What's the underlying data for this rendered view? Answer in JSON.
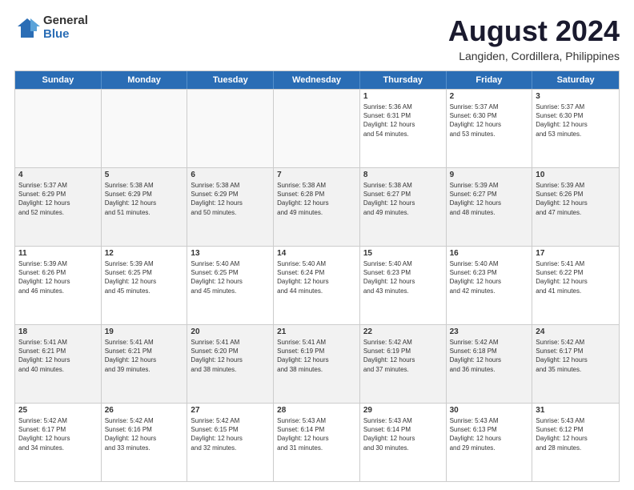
{
  "logo": {
    "general": "General",
    "blue": "Blue"
  },
  "title": "August 2024",
  "subtitle": "Langiden, Cordillera, Philippines",
  "header_days": [
    "Sunday",
    "Monday",
    "Tuesday",
    "Wednesday",
    "Thursday",
    "Friday",
    "Saturday"
  ],
  "weeks": [
    [
      {
        "day": "",
        "empty": true
      },
      {
        "day": "",
        "empty": true
      },
      {
        "day": "",
        "empty": true
      },
      {
        "day": "",
        "empty": true
      },
      {
        "day": "1",
        "lines": [
          "Sunrise: 5:36 AM",
          "Sunset: 6:31 PM",
          "Daylight: 12 hours",
          "and 54 minutes."
        ]
      },
      {
        "day": "2",
        "lines": [
          "Sunrise: 5:37 AM",
          "Sunset: 6:30 PM",
          "Daylight: 12 hours",
          "and 53 minutes."
        ]
      },
      {
        "day": "3",
        "lines": [
          "Sunrise: 5:37 AM",
          "Sunset: 6:30 PM",
          "Daylight: 12 hours",
          "and 53 minutes."
        ]
      }
    ],
    [
      {
        "day": "4",
        "lines": [
          "Sunrise: 5:37 AM",
          "Sunset: 6:29 PM",
          "Daylight: 12 hours",
          "and 52 minutes."
        ]
      },
      {
        "day": "5",
        "lines": [
          "Sunrise: 5:38 AM",
          "Sunset: 6:29 PM",
          "Daylight: 12 hours",
          "and 51 minutes."
        ]
      },
      {
        "day": "6",
        "lines": [
          "Sunrise: 5:38 AM",
          "Sunset: 6:29 PM",
          "Daylight: 12 hours",
          "and 50 minutes."
        ]
      },
      {
        "day": "7",
        "lines": [
          "Sunrise: 5:38 AM",
          "Sunset: 6:28 PM",
          "Daylight: 12 hours",
          "and 49 minutes."
        ]
      },
      {
        "day": "8",
        "lines": [
          "Sunrise: 5:38 AM",
          "Sunset: 6:27 PM",
          "Daylight: 12 hours",
          "and 49 minutes."
        ]
      },
      {
        "day": "9",
        "lines": [
          "Sunrise: 5:39 AM",
          "Sunset: 6:27 PM",
          "Daylight: 12 hours",
          "and 48 minutes."
        ]
      },
      {
        "day": "10",
        "lines": [
          "Sunrise: 5:39 AM",
          "Sunset: 6:26 PM",
          "Daylight: 12 hours",
          "and 47 minutes."
        ]
      }
    ],
    [
      {
        "day": "11",
        "lines": [
          "Sunrise: 5:39 AM",
          "Sunset: 6:26 PM",
          "Daylight: 12 hours",
          "and 46 minutes."
        ]
      },
      {
        "day": "12",
        "lines": [
          "Sunrise: 5:39 AM",
          "Sunset: 6:25 PM",
          "Daylight: 12 hours",
          "and 45 minutes."
        ]
      },
      {
        "day": "13",
        "lines": [
          "Sunrise: 5:40 AM",
          "Sunset: 6:25 PM",
          "Daylight: 12 hours",
          "and 45 minutes."
        ]
      },
      {
        "day": "14",
        "lines": [
          "Sunrise: 5:40 AM",
          "Sunset: 6:24 PM",
          "Daylight: 12 hours",
          "and 44 minutes."
        ]
      },
      {
        "day": "15",
        "lines": [
          "Sunrise: 5:40 AM",
          "Sunset: 6:23 PM",
          "Daylight: 12 hours",
          "and 43 minutes."
        ]
      },
      {
        "day": "16",
        "lines": [
          "Sunrise: 5:40 AM",
          "Sunset: 6:23 PM",
          "Daylight: 12 hours",
          "and 42 minutes."
        ]
      },
      {
        "day": "17",
        "lines": [
          "Sunrise: 5:41 AM",
          "Sunset: 6:22 PM",
          "Daylight: 12 hours",
          "and 41 minutes."
        ]
      }
    ],
    [
      {
        "day": "18",
        "lines": [
          "Sunrise: 5:41 AM",
          "Sunset: 6:21 PM",
          "Daylight: 12 hours",
          "and 40 minutes."
        ]
      },
      {
        "day": "19",
        "lines": [
          "Sunrise: 5:41 AM",
          "Sunset: 6:21 PM",
          "Daylight: 12 hours",
          "and 39 minutes."
        ]
      },
      {
        "day": "20",
        "lines": [
          "Sunrise: 5:41 AM",
          "Sunset: 6:20 PM",
          "Daylight: 12 hours",
          "and 38 minutes."
        ]
      },
      {
        "day": "21",
        "lines": [
          "Sunrise: 5:41 AM",
          "Sunset: 6:19 PM",
          "Daylight: 12 hours",
          "and 38 minutes."
        ]
      },
      {
        "day": "22",
        "lines": [
          "Sunrise: 5:42 AM",
          "Sunset: 6:19 PM",
          "Daylight: 12 hours",
          "and 37 minutes."
        ]
      },
      {
        "day": "23",
        "lines": [
          "Sunrise: 5:42 AM",
          "Sunset: 6:18 PM",
          "Daylight: 12 hours",
          "and 36 minutes."
        ]
      },
      {
        "day": "24",
        "lines": [
          "Sunrise: 5:42 AM",
          "Sunset: 6:17 PM",
          "Daylight: 12 hours",
          "and 35 minutes."
        ]
      }
    ],
    [
      {
        "day": "25",
        "lines": [
          "Sunrise: 5:42 AM",
          "Sunset: 6:17 PM",
          "Daylight: 12 hours",
          "and 34 minutes."
        ]
      },
      {
        "day": "26",
        "lines": [
          "Sunrise: 5:42 AM",
          "Sunset: 6:16 PM",
          "Daylight: 12 hours",
          "and 33 minutes."
        ]
      },
      {
        "day": "27",
        "lines": [
          "Sunrise: 5:42 AM",
          "Sunset: 6:15 PM",
          "Daylight: 12 hours",
          "and 32 minutes."
        ]
      },
      {
        "day": "28",
        "lines": [
          "Sunrise: 5:43 AM",
          "Sunset: 6:14 PM",
          "Daylight: 12 hours",
          "and 31 minutes."
        ]
      },
      {
        "day": "29",
        "lines": [
          "Sunrise: 5:43 AM",
          "Sunset: 6:14 PM",
          "Daylight: 12 hours",
          "and 30 minutes."
        ]
      },
      {
        "day": "30",
        "lines": [
          "Sunrise: 5:43 AM",
          "Sunset: 6:13 PM",
          "Daylight: 12 hours",
          "and 29 minutes."
        ]
      },
      {
        "day": "31",
        "lines": [
          "Sunrise: 5:43 AM",
          "Sunset: 6:12 PM",
          "Daylight: 12 hours",
          "and 28 minutes."
        ]
      }
    ]
  ]
}
